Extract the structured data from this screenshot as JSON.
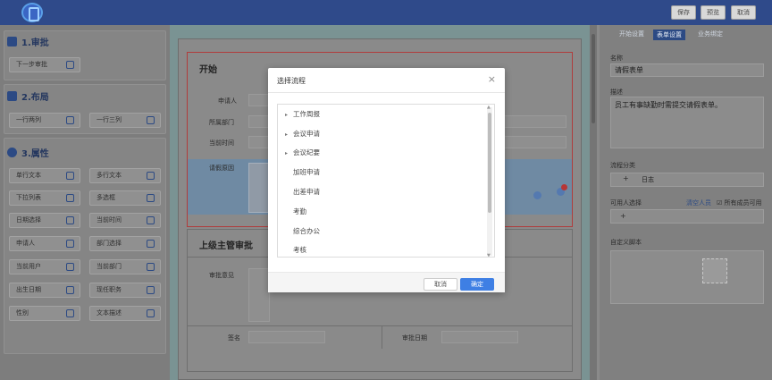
{
  "header": {
    "save": "保存",
    "preview": "预览",
    "cancel": "取消"
  },
  "left": {
    "approval": {
      "title": "1.审批",
      "items": [
        "下一步审批"
      ]
    },
    "layout": {
      "title": "2.布局",
      "items": [
        "一行两列",
        "一行三列"
      ]
    },
    "properties": {
      "title": "3.属性",
      "items": [
        "单行文本",
        "多行文本",
        "下拉列表",
        "多选框",
        "日期选择",
        "当前时间",
        "申请人",
        "部门选择",
        "当前用户",
        "当前部门",
        "出生日期",
        "现任职务",
        "性别",
        "文本描述"
      ]
    }
  },
  "form": {
    "start_title": "开始",
    "fields": [
      "申请人",
      "所属部门",
      "当前时间"
    ],
    "reason": "请假原因",
    "section2_title": "上级主管审批",
    "opinion": "审批意见",
    "sign": "签名",
    "approve_date": "审批日期"
  },
  "right": {
    "tabs": [
      "开始设置",
      "表单设置",
      "业务绑定"
    ],
    "name_label": "名称",
    "name_value": "请假表单",
    "desc_label": "描述",
    "desc_value": "员工有事缺勤时需提交请假表单。",
    "category_label": "流程分类",
    "category_value": "日志",
    "available_label": "可用人选择",
    "clear_people": "清空人员",
    "all_members": "所有成员可用",
    "custom_script": "自定义脚本"
  },
  "modal": {
    "title": "选择流程",
    "items": [
      {
        "label": "工作周报",
        "expandable": true
      },
      {
        "label": "会议申请",
        "expandable": true
      },
      {
        "label": "会议纪要",
        "expandable": true
      },
      {
        "label": "加班申请",
        "expandable": false
      },
      {
        "label": "出差申请",
        "expandable": false
      },
      {
        "label": "考勤",
        "expandable": false
      },
      {
        "label": "综合办公",
        "expandable": false
      },
      {
        "label": "考核",
        "expandable": false
      }
    ],
    "cancel": "取消",
    "ok": "确定",
    "close_icon": "×",
    "expand_arrow": "▸"
  }
}
